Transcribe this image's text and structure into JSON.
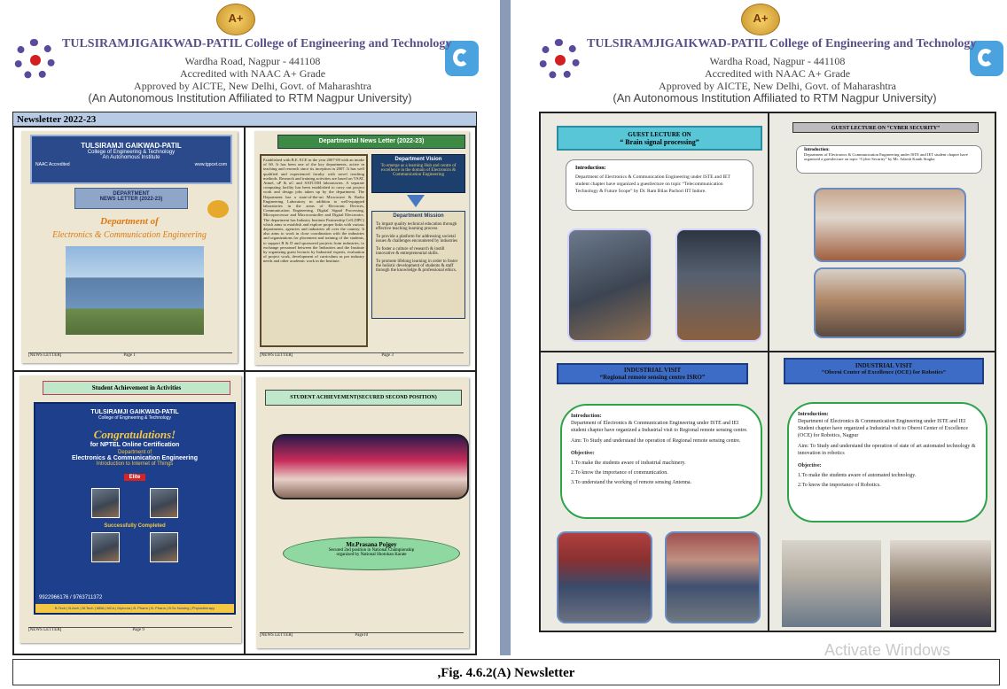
{
  "header": {
    "naac_badge": "A+",
    "college": "TULSIRAMJIGAIKWAD-PATIL College of Engineering and Technology",
    "address": "Wardha Road, Nagpur - 441108",
    "accreditation": "Accredited with NAAC A+ Grade",
    "approval": "Approved by AICTE, New Delhi, Govt. of Maharashtra",
    "autonomy": "(An Autonomous Institution Affiliated to RTM Nagpur University)"
  },
  "left": {
    "newsletter_title": "Newsletter 2022-23",
    "cover": {
      "inst_line1": "TULSIRAMJI GAIKWAD-PATIL",
      "inst_line2": "College of Engineering & Technology",
      "inst_line3": "An Autonomous Institute",
      "naac_accredited": "NAAC Accredited",
      "website": "www.tgpcet.com",
      "dept_label": "DEPARTMENT",
      "news_label": "NEWS LETTER (2022-23)",
      "dept_line1": "Department of",
      "dept_line2": "Electronics & Communication Engineering",
      "footer_left": "[NEWS LETTER]",
      "footer_page": "Page 1"
    },
    "news": {
      "title": "Departmental News Letter (2022-23)",
      "body": "Established with B.E. ECE in the year 2007-08 with an intake of 60. It has been one of the key departments, active in teaching and research since its inception in 2007. It has well qualified and experienced faculty with novel teaching methods. Research and training activities are based on VSAT, Atmel, uP & uC and SATCOM laboratories. A separate computing facility has been established to carry out project work and design jobs taken up by the department. The Department has a state-of-the-art Microwave & Radio Engineering Laboratory in addition to well-equipped laboratories in the areas of Electronic Devices, Communication Engineering, Digital Signal Processing, Microprocessor and Microcontroller and Digital Electronics. The department has Industry Institute Partnership Cell (IIPC) which aims to establish and explore proper links with various departments, agencies and industries all over the country. It also aims to work in close coordination with the industries and organizations for placement and training of the students, to support R & D and sponsored projects from industries, to exchange personnel between the Industries and the Institute by organizing guest lectures by Industrial experts, evaluation of project work, development of curriculum as per industry needs and other academic work in the Institute.",
      "vision_title": "Department Vision",
      "vision": "To emerge as a learning Hub and centre of excellence in the domain of Electronics & Communication Engineering",
      "mission_title": "Department Mission",
      "mission": [
        "To impart quality technical education through effective teaching learning process",
        "To provide a platform for addressing societal issues & challenges encountered by industries",
        "To foster a culture of research & instill innovative & entrepreneurial skills.",
        "To promote lifelong learning in order to foster the holistic development of students & staff through the knowledge & professional ethics."
      ],
      "footer_left": "[NEWS LETTER]",
      "footer_page": "Page 3"
    },
    "achieve": {
      "title": "Student Achievement in Activities",
      "inst": "TULSIRAMJI GAIKWAD-PATIL",
      "inst2": "College of Engineering & Technology",
      "congrats": "Congratulations!",
      "nptel_line": "for NPTEL Online Certification",
      "dept": "Department of",
      "dept2": "Electronics & Communication Engineering",
      "course": "Introduction to Internet of Things",
      "elite": "Elite",
      "success": "Successfully Completed",
      "phone": "9922966176 / 9763711372",
      "courses": "B.Tech | B.Arch | M.Tech | MBA | MCA | Diploma | B. Pharm | B. Pharm | B.Sc Nursing | Physiotherapy",
      "footer_left": "[NEWS LETTER]",
      "footer_page": "Page 9"
    },
    "second": {
      "title": "STUDENT ACHIEVEMENT(SECURED SECOND POSITION)",
      "name": "Mr.Prasana Pojgey",
      "desc1": "Secured 2nd position in National Championship",
      "desc2": "organized by National Shotokan Karate",
      "footer_left": "[NEWS LETTER]",
      "footer_page": "Page10"
    }
  },
  "right": {
    "brain": {
      "label": "GUEST LECTURE ON",
      "title": "“ Brain signal processing”",
      "intro": "Introduction:",
      "text": "Department of Electronics & Communication Engineering under ISTE and IET student chapter have organized a guestlecture on topic “Telecommunication Technology & Future Scope” by Dr. Ram Bilas Pachori IIT Indore."
    },
    "cyber": {
      "title": "GUEST LECTURE ON “CYBER SECURITY”",
      "intro": "Introduction:",
      "text": "Department of Electronics & Communication Engineering under ISTE and IET student chapter have organized a guestlecture on topic “Cyber Security” by Mr. Adarsh Kanth Singha"
    },
    "isro": {
      "label": "INDUSTRIAL VISIT",
      "title": "“Regional remote sensing centre ISRO”",
      "intro": "Introduction:",
      "text": "Department of Electronics & Communication Engineering under ISTE and IEI student chapter have organized a Industrial visit to Regional remote sensing centre.",
      "aim": "Aim: To Study and understand the operation of Regional remote sensing centre.",
      "objective": "Objective:",
      "objectives": [
        "1.To make the students aware of industrial machinery.",
        "2.To know the importance of communication.",
        "3.To understand the working of remote sensing Antenna."
      ]
    },
    "oberoi": {
      "label": "INDUSTRIAL VISIT",
      "title": "“Oberoi Center of Excellence (OCE) for Robotics”",
      "intro": "Introduction:",
      "text": "Department of Electronics & Communication Engineering under ISTE and IEI Student chapter have organized a Industrial visit to Oberoi Center of Excellence (OCE) for Robotics, Nagpur",
      "aim": "Aim: To Study and understand the operation of state of art automated technology & innovation in robotics",
      "objective": "Objective:",
      "objectives": [
        "1.To make the students aware of automated technology.",
        "2.To know the importance of Robotics."
      ]
    }
  },
  "watermark": "Activate Windows",
  "caption": ",Fig. 4.6.2(A) Newsletter"
}
